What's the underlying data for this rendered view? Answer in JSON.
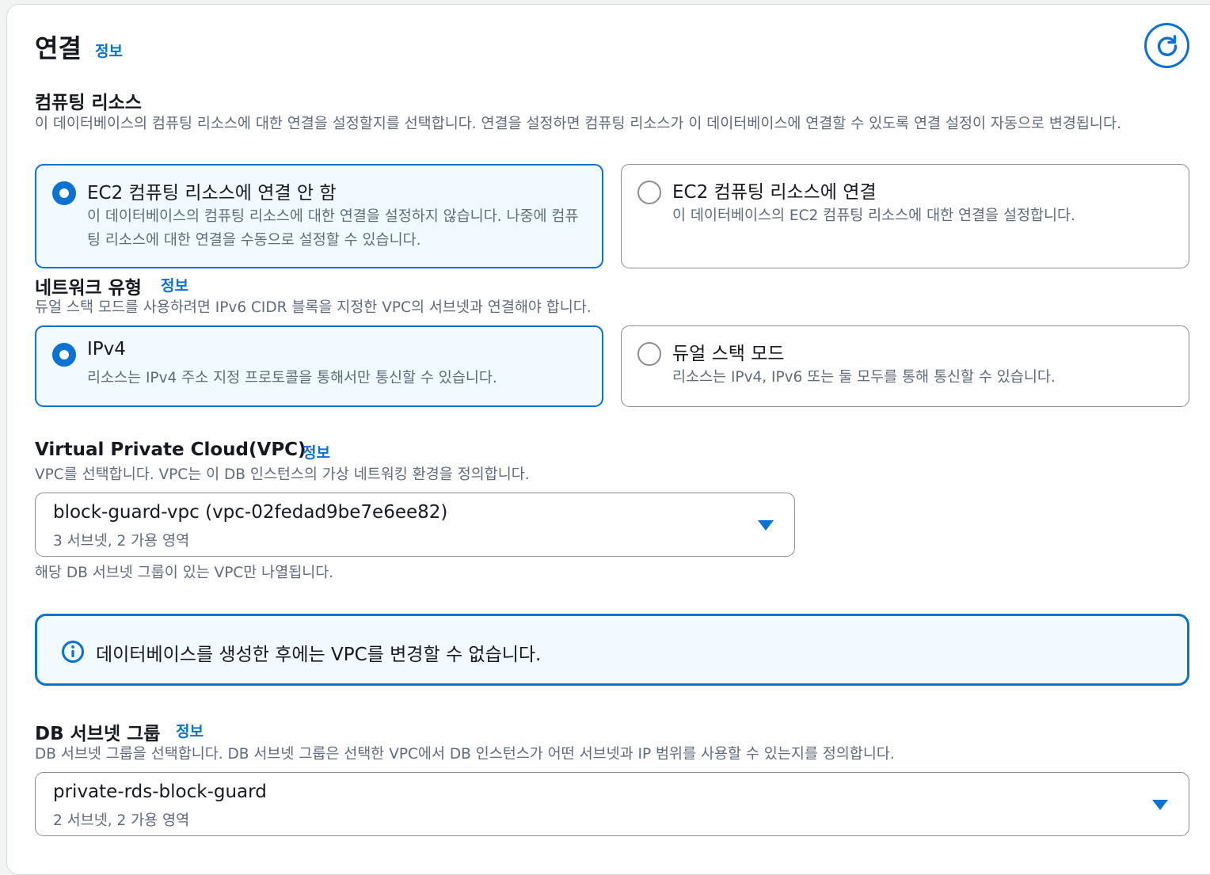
{
  "section": {
    "title": "연결",
    "info": "정보"
  },
  "compute": {
    "label": "컴퓨팅 리소스",
    "description": "이 데이터베이스의 컴퓨팅 리소스에 대한 연결을 설정할지를 선택합니다. 연결을 설정하면 컴퓨팅 리소스가 이 데이터베이스에 연결할 수 있도록 연결 설정이 자동으로 변경됩니다.",
    "options": [
      {
        "title": "EC2 컴퓨팅 리소스에 연결 안 함",
        "description": "이 데이터베이스의 컴퓨팅 리소스에 대한 연결을 설정하지 않습니다. 나중에 컴퓨팅 리소스에 대한 연결을 수동으로 설정할 수 있습니다.",
        "selected": true
      },
      {
        "title": "EC2 컴퓨팅 리소스에 연결",
        "description": "이 데이터베이스의 EC2 컴퓨팅 리소스에 대한 연결을 설정합니다.",
        "selected": false
      }
    ]
  },
  "network": {
    "label": "네트워크 유형",
    "info": "정보",
    "description": "듀얼 스택 모드를 사용하려면 IPv6 CIDR 블록을 지정한 VPC의 서브넷과 연결해야 합니다.",
    "options": [
      {
        "title": "IPv4",
        "description": "리소스는 IPv4 주소 지정 프로토콜을 통해서만 통신할 수 있습니다.",
        "selected": true
      },
      {
        "title": "듀얼 스택 모드",
        "description": "리소스는 IPv4, IPv6 또는 둘 모두를 통해 통신할 수 있습니다.",
        "selected": false
      }
    ]
  },
  "vpc": {
    "label": "Virtual Private Cloud(VPC)",
    "info": "정보",
    "description": "VPC를 선택합니다. VPC는 이 DB 인스턴스의 가상 네트워킹 환경을 정의합니다.",
    "selected_value": "block-guard-vpc (vpc-02fedad9be7e6ee82)",
    "selected_sub": "3 서브넷, 2 가용 영역",
    "hint": "해당 DB 서브넷 그룹이 있는 VPC만 나열됩니다."
  },
  "alert": {
    "text": "데이터베이스를 생성한 후에는 VPC를 변경할 수 없습니다."
  },
  "subnet_group": {
    "label": "DB 서브넷 그룹",
    "info": "정보",
    "description": "DB 서브넷 그룹을 선택합니다. DB 서브넷 그룹은 선택한 VPC에서 DB 인스턴스가 어떤 서브넷과 IP 범위를 사용할 수 있는지를 정의합니다.",
    "selected_value": "private-rds-block-guard",
    "selected_sub": "2 서브넷, 2 가용 영역"
  },
  "colors": {
    "accent": "#0972d3",
    "selected_bg": "#f1faff",
    "text": "#16191f",
    "muted": "#5f6b7a"
  },
  "icons": [
    "refresh-icon",
    "radio-icon",
    "caret-down-icon",
    "info-circle-icon"
  ]
}
